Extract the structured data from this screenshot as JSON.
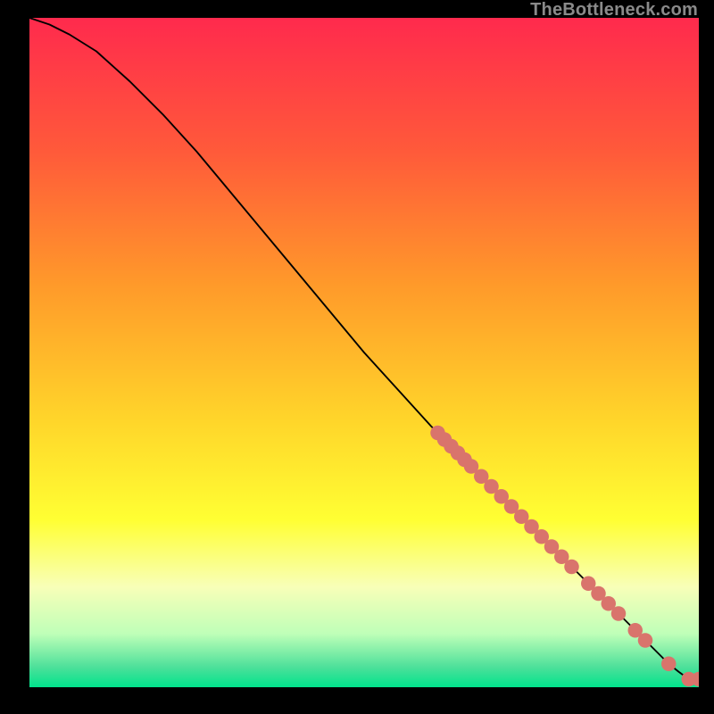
{
  "watermark": {
    "text": "TheBottleneck.com"
  },
  "chart_data": {
    "type": "line",
    "title": "",
    "xlabel": "",
    "ylabel": "",
    "xlim": [
      0,
      100
    ],
    "ylim": [
      0,
      100
    ],
    "background_gradient_stops": [
      {
        "offset": 0.0,
        "color": "#ff2a4d"
      },
      {
        "offset": 0.2,
        "color": "#ff5a3a"
      },
      {
        "offset": 0.4,
        "color": "#ff9a2a"
      },
      {
        "offset": 0.6,
        "color": "#ffd52a"
      },
      {
        "offset": 0.75,
        "color": "#ffff33"
      },
      {
        "offset": 0.85,
        "color": "#f8ffb8"
      },
      {
        "offset": 0.92,
        "color": "#bfffb8"
      },
      {
        "offset": 0.97,
        "color": "#4de09a"
      },
      {
        "offset": 1.0,
        "color": "#00e38c"
      }
    ],
    "curve": {
      "x": [
        0,
        3,
        6,
        10,
        15,
        20,
        25,
        30,
        35,
        40,
        45,
        50,
        55,
        60,
        65,
        70,
        75,
        80,
        85,
        88,
        90,
        92,
        94,
        95.5,
        97,
        98.5,
        100
      ],
      "y": [
        100,
        99,
        97.5,
        95,
        90.5,
        85.5,
        80,
        74,
        68,
        62,
        56,
        50,
        44.5,
        39,
        34,
        29,
        24,
        19,
        14,
        11,
        9,
        7,
        5,
        3.5,
        2.3,
        1.2,
        1.2
      ]
    },
    "series": [
      {
        "name": "marker-cluster",
        "type": "scatter",
        "color": "#d9746c",
        "radius": 1.1,
        "points": [
          {
            "x": 61.0,
            "y": 38.0
          },
          {
            "x": 62.0,
            "y": 37.0
          },
          {
            "x": 63.0,
            "y": 36.0
          },
          {
            "x": 64.0,
            "y": 35.0
          },
          {
            "x": 65.0,
            "y": 34.0
          },
          {
            "x": 66.0,
            "y": 33.0
          },
          {
            "x": 67.5,
            "y": 31.5
          },
          {
            "x": 69.0,
            "y": 30.0
          },
          {
            "x": 70.5,
            "y": 28.5
          },
          {
            "x": 72.0,
            "y": 27.0
          },
          {
            "x": 73.5,
            "y": 25.5
          },
          {
            "x": 75.0,
            "y": 24.0
          },
          {
            "x": 76.5,
            "y": 22.5
          },
          {
            "x": 78.0,
            "y": 21.0
          },
          {
            "x": 79.5,
            "y": 19.5
          },
          {
            "x": 81.0,
            "y": 18.0
          },
          {
            "x": 83.5,
            "y": 15.5
          },
          {
            "x": 85.0,
            "y": 14.0
          },
          {
            "x": 86.5,
            "y": 12.5
          },
          {
            "x": 88.0,
            "y": 11.0
          },
          {
            "x": 90.5,
            "y": 8.5
          },
          {
            "x": 92.0,
            "y": 7.0
          },
          {
            "x": 95.5,
            "y": 3.5
          },
          {
            "x": 98.5,
            "y": 1.2
          },
          {
            "x": 100.0,
            "y": 1.2
          }
        ]
      }
    ]
  }
}
